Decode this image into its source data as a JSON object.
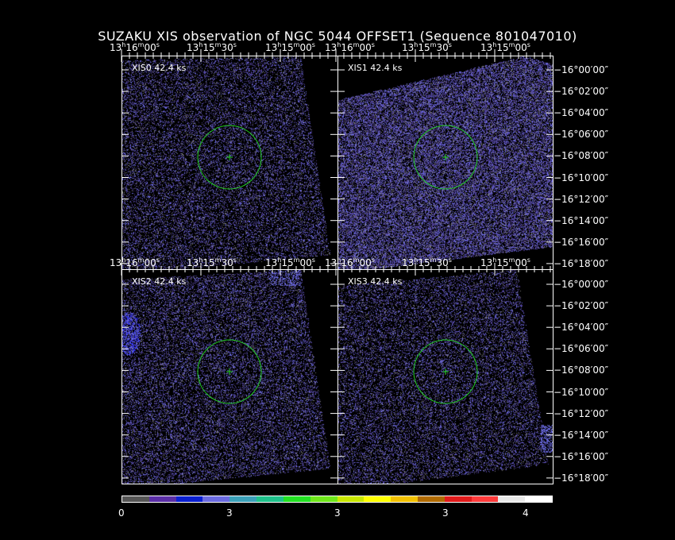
{
  "title": "SUZAKU XIS observation of NGC 5044 OFFSET1  (Sequence 801047010)",
  "panels": [
    {
      "label": "XIS0  42.4 ks"
    },
    {
      "label": "XIS1  42.4 ks"
    },
    {
      "label": "XIS2  42.4 ks"
    },
    {
      "label": "XIS3  42.4 ks"
    }
  ],
  "ra_labels": [
    "13h16m00s",
    "13h15m30s",
    "13h15m00s"
  ],
  "dec_labels": [
    "−16°00′00″",
    "−16°02′00″",
    "−16°04′00″",
    "−16°06′00″",
    "−16°08′00″",
    "−16°10′00″",
    "−16°12′00″",
    "−16°14′00″",
    "−16°16′00″",
    "−16°18′00″"
  ],
  "colorbar": {
    "colors": [
      "#555555",
      "#5a2ea6",
      "#0a1fd0",
      "#6a6ae0",
      "#3aa0b8",
      "#1ec08a",
      "#22e022",
      "#6ee61a",
      "#c8e600",
      "#ffff00",
      "#f2c000",
      "#b06a00",
      "#e01a1a",
      "#ff3a3a",
      "#e8e8e8",
      "#ffffff"
    ],
    "tick_labels": [
      "0",
      "3",
      "3",
      "3",
      "4"
    ]
  },
  "circle_color": "#22cc22"
}
